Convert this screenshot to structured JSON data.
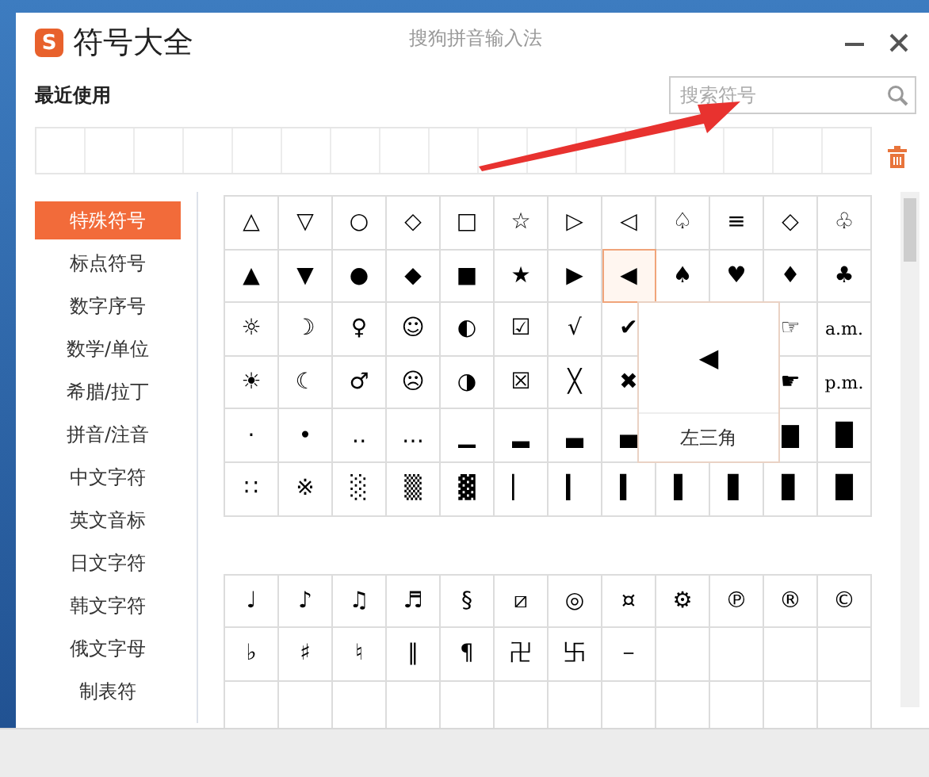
{
  "window": {
    "logo_letter": "S",
    "title": "符号大全",
    "app_name": "搜狗拼音输入法"
  },
  "recent": {
    "label": "最近使用"
  },
  "search": {
    "placeholder": "搜索符号"
  },
  "categories": [
    {
      "label": "特殊符号",
      "selected": true
    },
    {
      "label": "标点符号",
      "selected": false
    },
    {
      "label": "数字序号",
      "selected": false
    },
    {
      "label": "数学/单位",
      "selected": false
    },
    {
      "label": "希腊/拉丁",
      "selected": false
    },
    {
      "label": "拼音/注音",
      "selected": false
    },
    {
      "label": "中文字符",
      "selected": false
    },
    {
      "label": "英文音标",
      "selected": false
    },
    {
      "label": "日文字符",
      "selected": false
    },
    {
      "label": "韩文字符",
      "selected": false
    },
    {
      "label": "俄文字母",
      "selected": false
    },
    {
      "label": "制表符",
      "selected": false
    }
  ],
  "symbol_grids": [
    {
      "rows": [
        [
          {
            "s": "△",
            "selected": false
          },
          {
            "s": "▽",
            "selected": false
          },
          {
            "s": "○",
            "selected": false
          },
          {
            "s": "◇",
            "selected": false
          },
          {
            "s": "□",
            "selected": false
          },
          {
            "s": "☆",
            "selected": false
          },
          {
            "s": "▷",
            "selected": false
          },
          {
            "s": "◁",
            "selected": false
          },
          {
            "s": "♤",
            "selected": false
          },
          {
            "s": "≡",
            "selected": false
          },
          {
            "s": "◇",
            "selected": false
          },
          {
            "s": "♧",
            "selected": false
          }
        ],
        [
          {
            "s": "▲",
            "selected": false
          },
          {
            "s": "▼",
            "selected": false
          },
          {
            "s": "●",
            "selected": false
          },
          {
            "s": "◆",
            "selected": false
          },
          {
            "s": "■",
            "selected": false
          },
          {
            "s": "★",
            "selected": false
          },
          {
            "s": "▶",
            "selected": false
          },
          {
            "s": "◀",
            "selected": true
          },
          {
            "s": "♠",
            "selected": false
          },
          {
            "s": "♥",
            "selected": false
          },
          {
            "s": "♦",
            "selected": false
          },
          {
            "s": "♣",
            "selected": false
          }
        ],
        [
          {
            "s": "☼",
            "selected": false
          },
          {
            "s": "☽",
            "selected": false
          },
          {
            "s": "♀",
            "selected": false
          },
          {
            "s": "☺",
            "selected": false
          },
          {
            "s": "◐",
            "selected": false
          },
          {
            "s": "☑",
            "selected": false
          },
          {
            "s": "√",
            "selected": false
          },
          {
            "s": "✔",
            "selected": false
          },
          null,
          null,
          {
            "s": "☞",
            "selected": false
          },
          {
            "s": "a.m.",
            "selected": false
          }
        ],
        [
          {
            "s": "☀",
            "selected": false
          },
          {
            "s": "☾",
            "selected": false
          },
          {
            "s": "♂",
            "selected": false
          },
          {
            "s": "☹",
            "selected": false
          },
          {
            "s": "◑",
            "selected": false
          },
          {
            "s": "☒",
            "selected": false
          },
          {
            "s": "╳",
            "selected": false
          },
          {
            "s": "✖",
            "selected": false
          },
          null,
          null,
          {
            "s": "☛",
            "selected": false
          },
          {
            "s": "p.m.",
            "selected": false
          }
        ],
        [
          {
            "s": "·",
            "selected": false
          },
          {
            "s": "•",
            "selected": false
          },
          {
            "s": "‥",
            "selected": false
          },
          {
            "s": "…",
            "selected": false
          },
          {
            "s": "▁",
            "selected": false
          },
          {
            "s": "▂",
            "selected": false
          },
          {
            "s": "▃",
            "selected": false
          },
          {
            "s": "▄",
            "selected": false
          },
          null,
          null,
          {
            "s": "▇",
            "selected": false
          },
          {
            "s": "█",
            "selected": false
          }
        ],
        [
          {
            "s": "∷",
            "selected": false
          },
          {
            "s": "※",
            "selected": false
          },
          {
            "s": "░",
            "selected": false
          },
          {
            "s": "▒",
            "selected": false
          },
          {
            "s": "▓",
            "selected": false
          },
          {
            "s": "▏",
            "selected": false
          },
          {
            "s": "▎",
            "selected": false
          },
          {
            "s": "▍",
            "selected": false
          },
          {
            "s": "▌",
            "selected": false
          },
          {
            "s": "▋",
            "selected": false
          },
          {
            "s": "▊",
            "selected": false
          },
          {
            "s": "█",
            "selected": false
          }
        ]
      ]
    },
    {
      "rows": [
        [
          {
            "s": "♩",
            "selected": false
          },
          {
            "s": "♪",
            "selected": false
          },
          {
            "s": "♫",
            "selected": false
          },
          {
            "s": "♬",
            "selected": false
          },
          {
            "s": "§",
            "selected": false
          },
          {
            "s": "⧄",
            "selected": false
          },
          {
            "s": "◎",
            "selected": false
          },
          {
            "s": "¤",
            "selected": false
          },
          {
            "s": "⚙",
            "selected": false
          },
          {
            "s": "℗",
            "selected": false
          },
          {
            "s": "®",
            "selected": false
          },
          {
            "s": "©",
            "selected": false
          }
        ],
        [
          {
            "s": "♭",
            "selected": false
          },
          {
            "s": "♯",
            "selected": false
          },
          {
            "s": "♮",
            "selected": false
          },
          {
            "s": "‖",
            "selected": false
          },
          {
            "s": "¶",
            "selected": false
          },
          {
            "s": "卍",
            "selected": false
          },
          {
            "s": "卐",
            "selected": false
          },
          {
            "s": "－",
            "selected": false
          },
          {
            "selected": false
          },
          {
            "selected": false
          },
          {
            "selected": false
          },
          {
            "selected": false
          }
        ],
        [
          null,
          null,
          null,
          null,
          null,
          null,
          null,
          null,
          null,
          null,
          null,
          null
        ]
      ]
    }
  ],
  "preview": {
    "symbol": "◀",
    "name": "左三角"
  }
}
